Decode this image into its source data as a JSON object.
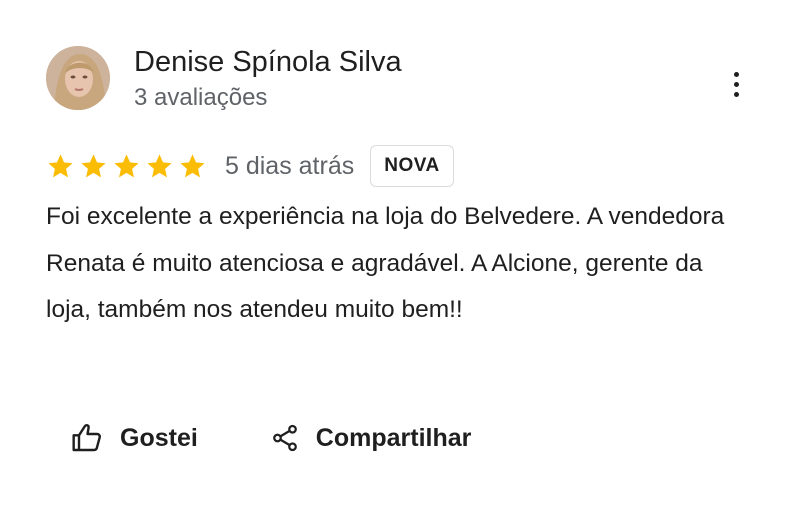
{
  "reviewer": {
    "name": "Denise Spínola Silva",
    "reviews_count": "3 avaliações",
    "avatar_icon": "profile-photo"
  },
  "menu": {
    "icon": "more-vert-icon"
  },
  "rating": {
    "stars": 5,
    "max_stars": 5,
    "star_color": "#fbbc04",
    "date": "5 dias atrás",
    "badge": "NOVA"
  },
  "review": {
    "text": "Foi excelente a experiência na loja do Belvedere. A vendedora Renata é muito atenciosa e agradável. A Alcione, gerente da loja, também nos atendeu muito bem!!"
  },
  "actions": {
    "like_label": "Gostei",
    "like_icon": "thumb-up-icon",
    "share_label": "Compartilhar",
    "share_icon": "share-icon"
  }
}
